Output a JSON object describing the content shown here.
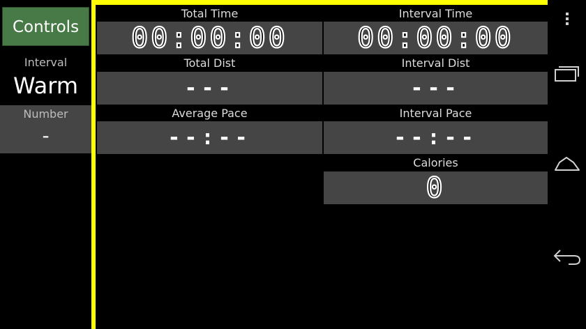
{
  "left_panel": {
    "controls_label": "Controls",
    "interval_label": "Interval",
    "interval_value": "Warm",
    "number_label": "Number",
    "number_value": "-"
  },
  "metrics": {
    "total_time": {
      "label": "Total Time",
      "value": "00:00:00"
    },
    "interval_time": {
      "label": "Interval Time",
      "value": "00:00:00"
    },
    "total_dist": {
      "label": "Total Dist",
      "value": "---"
    },
    "interval_dist": {
      "label": "Interval Dist",
      "value": "---"
    },
    "average_pace": {
      "label": "Average Pace",
      "value": "--:--"
    },
    "interval_pace": {
      "label": "Interval Pace",
      "value": "--:--"
    },
    "calories": {
      "label": "Calories",
      "value": "0"
    }
  },
  "navbar": {
    "icons": [
      "overflow-menu-icon",
      "recent-apps-icon",
      "home-icon",
      "back-icon"
    ]
  },
  "colors": {
    "accent_yellow": "#ffff00",
    "controls_green": "#477a46",
    "box_gray": "#454545"
  }
}
